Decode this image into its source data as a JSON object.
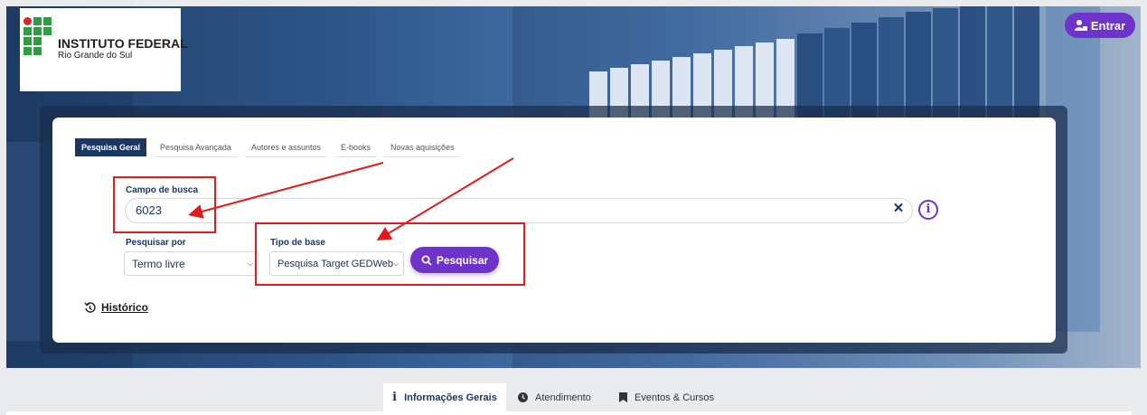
{
  "header": {
    "logo_name": "INSTITUTO FEDERAL",
    "logo_sub": "Rio Grande do Sul",
    "login_label": "Entrar"
  },
  "search": {
    "tabs": [
      {
        "label": "Pesquisa Geral",
        "active": true
      },
      {
        "label": "Pesquisa Avançada",
        "active": false
      },
      {
        "label": "Autores e assuntos",
        "active": false
      },
      {
        "label": "E-books",
        "active": false
      },
      {
        "label": "Novas aquisições",
        "active": false
      }
    ],
    "field_label": "Campo de busca",
    "field_value": "6023",
    "search_by_label": "Pesquisar por",
    "search_by_value": "Termo livre",
    "base_type_label": "Tipo de base",
    "base_type_value": "Pesquisa Target GEDWeb",
    "submit_label": "Pesquisar",
    "history_label": "Histórico"
  },
  "bottom_tabs": [
    {
      "label": "Informações Gerais",
      "active": true,
      "icon": "info-icon"
    },
    {
      "label": "Atendimento",
      "active": false,
      "icon": "clock-icon"
    },
    {
      "label": "Eventos & Cursos",
      "active": false,
      "icon": "bookmark-icon"
    }
  ],
  "colors": {
    "accent": "#6f33c9",
    "navy": "#1b3660",
    "annotation_red": "#e01b1b"
  }
}
